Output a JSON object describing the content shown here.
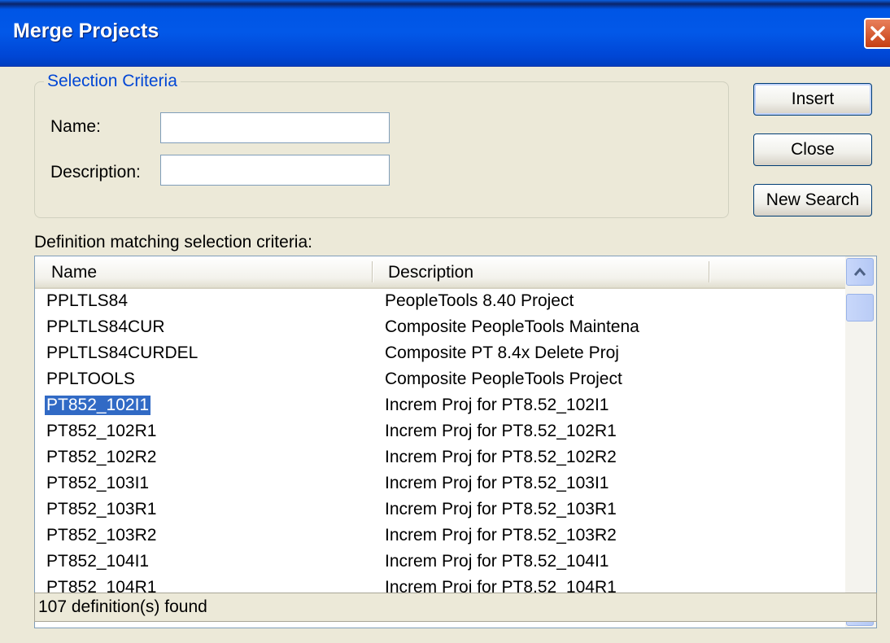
{
  "window": {
    "title": "Merge Projects"
  },
  "criteria": {
    "group_label": "Selection Criteria",
    "name_label": "Name:",
    "name_value": "",
    "description_label": "Description:",
    "description_value": ""
  },
  "buttons": {
    "insert": "Insert",
    "close": "Close",
    "new_search": "New Search"
  },
  "list": {
    "caption": "Definition matching selection criteria:",
    "columns": {
      "name": "Name",
      "description": "Description"
    },
    "selected_index": 4,
    "rows": [
      {
        "name": "PPLTLS84",
        "description": "PeopleTools 8.40 Project"
      },
      {
        "name": "PPLTLS84CUR",
        "description": "Composite PeopleTools Maintena"
      },
      {
        "name": "PPLTLS84CURDEL",
        "description": "Composite PT 8.4x Delete Proj"
      },
      {
        "name": "PPLTOOLS",
        "description": "Composite PeopleTools Project"
      },
      {
        "name": "PT852_102I1",
        "description": "Increm Proj for PT8.52_102I1"
      },
      {
        "name": "PT852_102R1",
        "description": "Increm Proj for PT8.52_102R1"
      },
      {
        "name": "PT852_102R2",
        "description": "Increm Proj for PT8.52_102R2"
      },
      {
        "name": "PT852_103I1",
        "description": "Increm Proj for PT8.52_103I1"
      },
      {
        "name": "PT852_103R1",
        "description": "Increm Proj for PT8.52_103R1"
      },
      {
        "name": "PT852_103R2",
        "description": "Increm Proj for PT8.52_103R2"
      },
      {
        "name": "PT852_104I1",
        "description": "Increm Proj for PT8.52_104I1"
      },
      {
        "name": "PT852_104R1",
        "description": "Increm Proj for PT8.52_104R1"
      }
    ]
  },
  "status": {
    "text": "107 definition(s) found"
  },
  "colors": {
    "titlebar": "#0055E5",
    "selection": "#316AC5",
    "group_label": "#0046D5",
    "dialog_bg": "#ECE9D8"
  },
  "icons": {
    "close": "close-icon",
    "scroll_up": "scroll-up-arrow-icon",
    "scroll_down": "scroll-down-arrow-icon"
  }
}
